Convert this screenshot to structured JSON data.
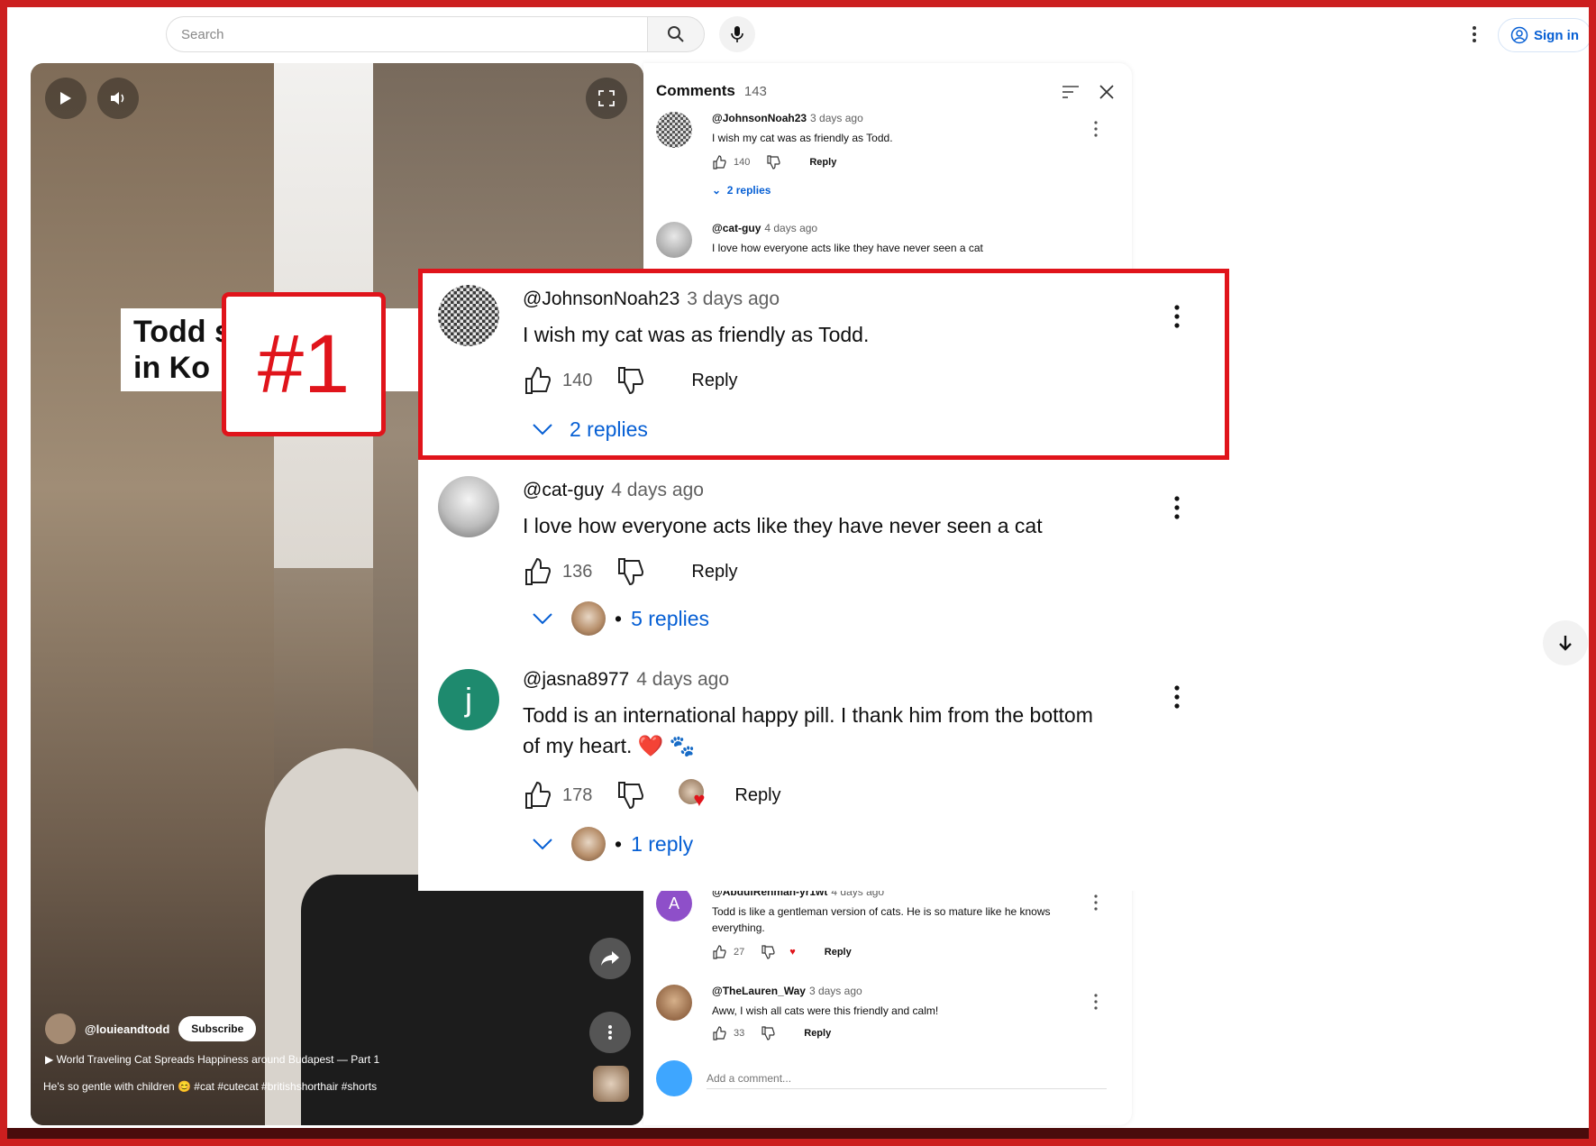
{
  "topbar": {
    "search_placeholder": "Search",
    "search_icon": "search-icon",
    "mic_icon": "mic-icon",
    "more_icon": "more-vertical-icon",
    "sign_in_label": "Sign in"
  },
  "video": {
    "title_line1": "Todd s        ha",
    "title_line2": "in Ko          ne",
    "channel_name": "@louieandtodd",
    "subscribe_label": "Subscribe",
    "playlist": "World Traveling Cat Spreads Happiness around Budapest — Part 1",
    "description": "He's so gentle with children 😊 #cat #cutecat #britishshorthair #shorts",
    "share_label": "Share"
  },
  "comments_panel": {
    "title": "Comments",
    "count": "143",
    "items": [
      {
        "author": "@JohnsonNoah23",
        "time": "3 days ago",
        "text": "I wish my cat was as friendly as Todd.",
        "likes": "140",
        "reply_label": "Reply",
        "replies": "2 replies"
      },
      {
        "author": "@cat-guy",
        "time": "4 days ago",
        "text": "I love how everyone acts like they have never seen a cat"
      },
      {
        "author": "@AbdulRehman-yr1wt",
        "time": "4 days ago",
        "text": "Todd is like a gentleman version of cats. He is so mature like he knows everything.",
        "likes": "27",
        "reply_label": "Reply",
        "avatar_letter": "A"
      },
      {
        "author": "@TheLauren_Way",
        "time": "3 days ago",
        "text": "Aww, I wish all cats were this friendly and calm!",
        "likes": "33",
        "reply_label": "Reply"
      }
    ],
    "add_comment_placeholder": "Add a comment..."
  },
  "zoomed": {
    "highlight_label": "#1",
    "comments": [
      {
        "author": "@JohnsonNoah23",
        "time": "3 days ago",
        "text": "I wish my cat was as friendly as Todd.",
        "likes": "140",
        "reply_label": "Reply",
        "replies": "2 replies"
      },
      {
        "author": "@cat-guy",
        "time": "4 days ago",
        "text": "I love how everyone acts like they have never seen a cat",
        "likes": "136",
        "reply_label": "Reply",
        "replies": "5 replies",
        "dot": "•"
      },
      {
        "author": "@jasna8977",
        "time": "4 days ago",
        "text_line1": "Todd is an international happy pill. I thank him from the bottom",
        "text_line2": "of my heart. ❤️ 🐾",
        "likes": "178",
        "reply_label": "Reply",
        "replies": "1 reply",
        "dot": "•",
        "avatar_letter": "j"
      }
    ]
  },
  "colors": {
    "frame": "#cc1f1f",
    "highlight": "#e0141b",
    "link_blue": "#065fd4",
    "jasna_avatar": "#1e8a6e",
    "abdul_avatar": "#8e4fc9"
  }
}
